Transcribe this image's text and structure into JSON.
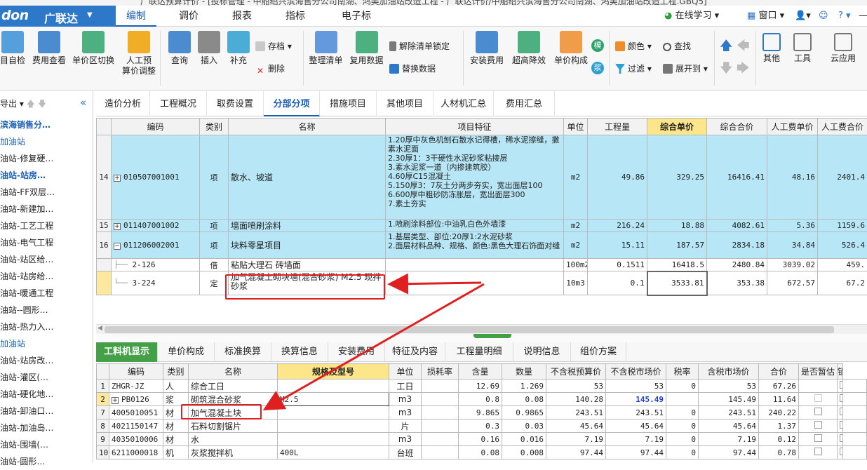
{
  "titlebar": {
    "text": "广联达预算计价 - [投标管理 - 中船绍兴滨海售分公司南湖、鸿美加油站改造工程 - 广联达计价/中船绍兴滨海售分公司南湖、鸿美加油站改造工程.GBQ5]"
  },
  "app": {
    "logo_text": "don",
    "logo_cn": "广联达"
  },
  "menu": {
    "tabs": [
      "编制",
      "调价",
      "报表",
      "指标",
      "电子标"
    ],
    "active": "编制",
    "right": {
      "learn": "在线学习",
      "window": "窗口",
      "help": "?"
    }
  },
  "ribbon": {
    "big": [
      {
        "label": "目自检",
        "icon": "check-icon"
      },
      {
        "label": "费用查看",
        "icon": "cost-view-icon"
      },
      {
        "label": "单价区切换",
        "icon": "switch-icon"
      },
      {
        "label": "人工预\n算价调整",
        "icon": "person-adjust-icon"
      },
      {
        "label": "查询",
        "icon": "query-icon"
      },
      {
        "label": "插入",
        "icon": "insert-icon"
      },
      {
        "label": "补充",
        "icon": "supplement-icon"
      },
      {
        "label": "整理清单",
        "icon": "organize-icon"
      },
      {
        "label": "复用数据",
        "icon": "reuse-icon"
      },
      {
        "label": "安装费用",
        "icon": "install-fee-icon"
      },
      {
        "label": "超高降效",
        "icon": "height-icon"
      },
      {
        "label": "单价构成",
        "icon": "unit-price-icon"
      },
      {
        "label": "其他",
        "icon": "grid-icon"
      },
      {
        "label": "工具",
        "icon": "tools-icon"
      },
      {
        "label": "云应用",
        "icon": "cloud-icon"
      }
    ],
    "small": {
      "save": "存档",
      "delete": "删除",
      "unlock": "解除清单锁定",
      "replace": "替换数据",
      "color": "颜色",
      "find": "查找",
      "filter": "过滤",
      "expand": "展开到",
      "badge1": "模",
      "badge2": "浆"
    }
  },
  "left": {
    "toolbar": "导出",
    "items": [
      "滨海销售分…",
      "加油站",
      "油站-修复硬…",
      "油站-站房…",
      "油站-FF双层…",
      "油站-新建加…",
      "油站-工艺工程",
      "油站-电气工程",
      "油站-站区给…",
      "油站-站房给…",
      "油站-暖通工程",
      "油站--圆形…",
      "油站-热力入…",
      "加油站",
      "油站-站房改…",
      "油站-灌区(…",
      "油站-硬化地…",
      "油站-卸油口…",
      "油站-加油岛…",
      "油站-围墙(…",
      "油站-圆形…"
    ]
  },
  "subtabs": {
    "items": [
      "造价分析",
      "工程概况",
      "取费设置",
      "分部分项",
      "措施项目",
      "其他项目",
      "人材机汇总",
      "费用汇总"
    ],
    "active": "分部分项"
  },
  "grid": {
    "headers": [
      "编码",
      "类别",
      "名称",
      "项目特征",
      "单位",
      "工程量",
      "综合单价",
      "综合合价",
      "人工费单价",
      "人工费合价"
    ],
    "rows": [
      {
        "no": "14",
        "code": "010507001001",
        "type": "项",
        "name": "散水、坡道",
        "feature": "1.20厚中灰色机刨石散水记得槽，稀水泥擦缝，撒素水泥面\n2.30厚1：3干硬性水泥砂浆粘接层\n3.素水泥浆一道（内掺建筑胶）\n4.60厚C15混凝土\n5.150厚3：7灰土分两步夯实，宽出面层100\n6.600厚中粗砂防冻胀层，宽出面层300\n7.素土夯实",
        "unit": "m2",
        "qty": "49.86",
        "uprice": "329.25",
        "total": "16416.41",
        "labor_u": "48.16",
        "labor_t": "2401.4"
      },
      {
        "no": "15",
        "code": "011407001002",
        "type": "项",
        "name": "墙面喷刷涂料",
        "feature": "1.喷刷涂料部位:中油乳白色外墙漆",
        "unit": "m2",
        "qty": "216.24",
        "uprice": "18.88",
        "total": "4082.61",
        "labor_u": "5.36",
        "labor_t": "1159.6"
      },
      {
        "no": "16",
        "code": "011206002001",
        "type": "项",
        "name": "块料零星项目",
        "feature": "1.基层类型、部位:20厚1:2水泥砂浆\n2.面层材料品种、规格、颜色:黑色大理石饰面对缝",
        "unit": "m2",
        "qty": "15.11",
        "uprice": "187.57",
        "total": "2834.18",
        "labor_u": "34.84",
        "labor_t": "526.4"
      },
      {
        "no": "",
        "code": "2-126",
        "type": "借",
        "name": "粘贴大理石 砖墙面",
        "feature": "",
        "unit": "100m2",
        "qty": "0.1511",
        "uprice": "16418.5",
        "total": "2480.84",
        "labor_u": "3039.02",
        "labor_t": "459."
      },
      {
        "no": "",
        "code": "3-224",
        "type": "定",
        "name": "加气混凝土砌块墙(混合砂浆) M2.5 现拌砂浆",
        "feature": "",
        "unit": "10m3",
        "qty": "0.1",
        "uprice": "3533.81",
        "total": "353.38",
        "labor_u": "672.57",
        "labor_t": "67.2"
      }
    ]
  },
  "bottom_tabs": {
    "items": [
      "工料机显示",
      "单价构成",
      "标准换算",
      "换算信息",
      "安装费用",
      "特征及内容",
      "工程量明细",
      "说明信息",
      "组价方案"
    ],
    "active": "工料机显示"
  },
  "grid2": {
    "headers": [
      "编码",
      "类别",
      "名称",
      "规格及型号",
      "单位",
      "损耗率",
      "含量",
      "数量",
      "不含税预算价",
      "不含税市场价",
      "税率",
      "含税市场价",
      "合价",
      "是否暂估",
      "锁定数"
    ],
    "rows": [
      {
        "no": "1",
        "code": "ZHGR-JZ",
        "type": "人",
        "name": "综合工日",
        "spec": "",
        "unit": "工日",
        "loss": "",
        "content": "12.69",
        "qty": "1.269",
        "budget": "53",
        "market": "53",
        "tax": "0",
        "tax_market": "53",
        "total": "67.26",
        "est": false,
        "lock": true
      },
      {
        "no": "2",
        "code": "PB0126",
        "type": "浆",
        "name": "砌筑混合砂浆",
        "spec": "M2.5",
        "unit": "m3",
        "loss": "",
        "content": "0.8",
        "qty": "0.08",
        "budget": "140.28",
        "market": "145.49",
        "tax": "",
        "tax_market": "145.49",
        "total": "11.64",
        "est": true,
        "lock": true
      },
      {
        "no": "7",
        "code": "4005010051",
        "type": "材",
        "name": "加气混凝土块",
        "spec": "",
        "unit": "m3",
        "loss": "",
        "content": "9.865",
        "qty": "0.9865",
        "budget": "243.51",
        "market": "243.51",
        "tax": "0",
        "tax_market": "243.51",
        "total": "240.22",
        "est": true,
        "lock": true
      },
      {
        "no": "8",
        "code": "4021150147",
        "type": "材",
        "name": "石料切割锯片",
        "spec": "",
        "unit": "片",
        "loss": "",
        "content": "0.3",
        "qty": "0.03",
        "budget": "45.64",
        "market": "45.64",
        "tax": "0",
        "tax_market": "45.64",
        "total": "1.37",
        "est": true,
        "lock": true
      },
      {
        "no": "9",
        "code": "4035010006",
        "type": "材",
        "name": "水",
        "spec": "",
        "unit": "m3",
        "loss": "",
        "content": "0.16",
        "qty": "0.016",
        "budget": "7.19",
        "market": "7.19",
        "tax": "0",
        "tax_market": "7.19",
        "total": "0.12",
        "est": true,
        "lock": true
      },
      {
        "no": "10",
        "code": "6211000018",
        "type": "机",
        "name": "灰浆搅拌机",
        "spec": "400L",
        "unit": "台班",
        "loss": "",
        "content": "0.08",
        "qty": "0.008",
        "budget": "97.44",
        "market": "97.44",
        "tax": "0",
        "tax_market": "97.44",
        "total": "0.78",
        "est": true,
        "lock": true
      }
    ]
  }
}
